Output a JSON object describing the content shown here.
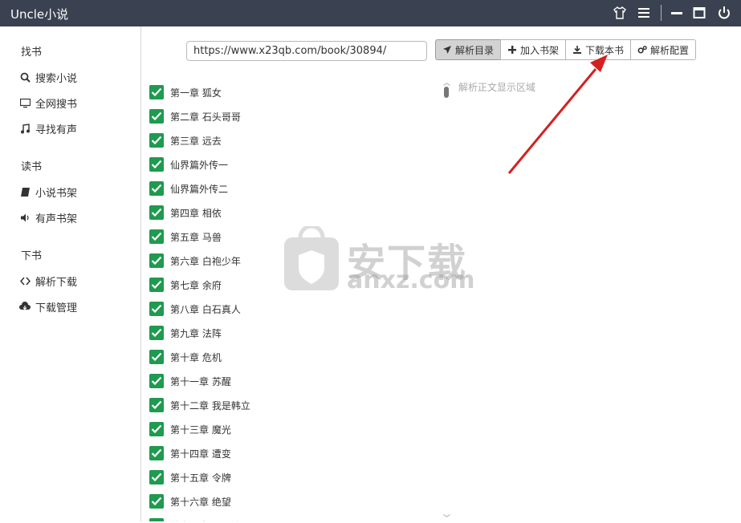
{
  "app": {
    "title": "Uncle小说"
  },
  "titlebar": {
    "icons": [
      "shirt-icon",
      "menu-icon",
      "minimize-icon",
      "maximize-icon",
      "power-icon"
    ]
  },
  "sidebar": {
    "sections": [
      {
        "title": "找书",
        "items": [
          {
            "label": "搜索小说",
            "icon": "search-icon"
          },
          {
            "label": "全网搜书",
            "icon": "monitor-icon"
          },
          {
            "label": "寻找有声",
            "icon": "music-icon"
          }
        ]
      },
      {
        "title": "读书",
        "items": [
          {
            "label": "小说书架",
            "icon": "book-icon"
          },
          {
            "label": "有声书架",
            "icon": "volume-icon"
          }
        ]
      },
      {
        "title": "下书",
        "items": [
          {
            "label": "解析下载",
            "icon": "code-icon"
          },
          {
            "label": "下载管理",
            "icon": "cloud-download-icon"
          }
        ]
      }
    ]
  },
  "toolbar": {
    "url_value": "https://www.x23qb.com/book/30894/",
    "buttons": {
      "parse_toc": "解析目录",
      "add_shelf": "加入书架",
      "download_book": "下载本书",
      "parse_config": "解析配置"
    }
  },
  "chapters": [
    "第一章 狐女",
    "第二章 石头哥哥",
    "第三章 远去",
    "仙界篇外传一",
    "仙界篇外传二",
    "第四章 相依",
    "第五章 马兽",
    "第六章 白袍少年",
    "第七章 余府",
    "第八章 白石真人",
    "第九章 法阵",
    "第十章 危机",
    "第十一章 苏醒",
    "第十二章 我是韩立",
    "第十三章 魔光",
    "第十四章 遭变",
    "第十五章 令牌",
    "第十六章 绝望",
    "第十七章 王二峰"
  ],
  "preview": {
    "placeholder": "解析正文显示区域"
  },
  "watermark": {
    "cn": "安下载",
    "url": "anxz.com",
    "badge": "安"
  },
  "colors": {
    "titlebar": "#3a4150",
    "checkbox": "#1f9a4f",
    "arrow": "#d42020"
  }
}
